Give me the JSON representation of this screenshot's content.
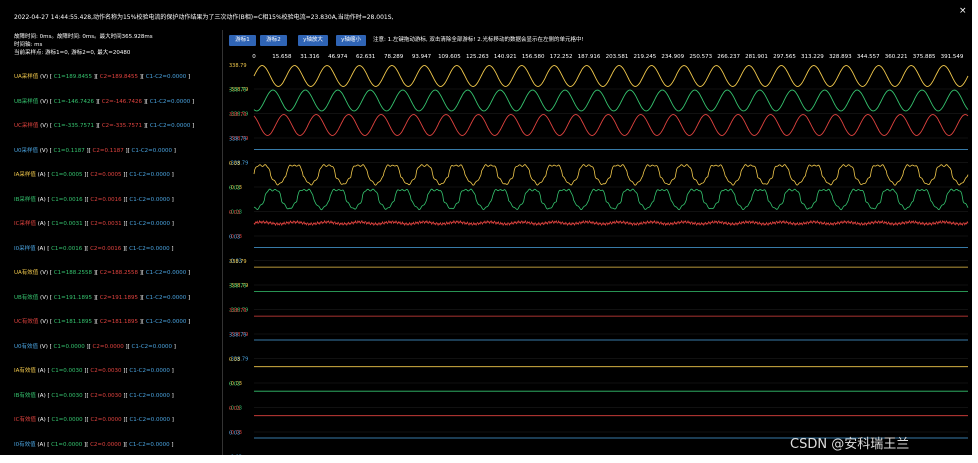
{
  "header": {
    "text": "2022-04-27 14:44:55.428,动作名称为15%校验电流的保护动作结果为了三次动作(B相)=C相15%校验电流=23.830A,当动作时=28.001S,"
  },
  "window": {
    "close_label": "×"
  },
  "info": {
    "line1": "故障时间: 0ms。故障时间: 0ms。最大时间365.928ms",
    "line2": "时间轴: ms",
    "line3": "当前采样点: 游标1=0, 游标2=0, 最大=20480"
  },
  "toolbar": {
    "cursor1": "游标1",
    "cursor2": "游标2",
    "y_zoom_in": "y轴放大",
    "y_zoom_out": "y轴缩小",
    "notice": "注意: 1.左键拖动游标, 双击清除全部游标! 2.光标移动的数据会显示在左侧的单元格中!"
  },
  "axis": {
    "ticks": [
      "0",
      "15.658",
      "31.316",
      "46.974",
      "62.631",
      "78.289",
      "93.947",
      "109.605",
      "125.263",
      "140.921",
      "156.580",
      "172.252",
      "187.916",
      "203.581",
      "219.245",
      "234.909",
      "250.573",
      "266.237",
      "281.901",
      "297.565",
      "313.229",
      "328.893",
      "344.557",
      "360.221",
      "375.885",
      "391.549"
    ]
  },
  "channels": [
    {
      "name": "UA采样值",
      "unit": "(V)",
      "c1": "C1=189.8455",
      "c2": "C2=189.8455",
      "diff": "C1-C2=0.0000",
      "color": "#f2c94c",
      "ymax": "338.79",
      "ymin": "-338.79",
      "wave": "sine",
      "phase": 0,
      "amp": 1
    },
    {
      "name": "UB采样值",
      "unit": "(V)",
      "c1": "C1=-146.7426",
      "c2": "C2=-146.7426",
      "diff": "C1-C2=0.0000",
      "color": "#35c46f",
      "ymax": "338.79",
      "ymin": "-338.79",
      "wave": "sine",
      "phase": -2.094,
      "amp": 1
    },
    {
      "name": "UC采样值",
      "unit": "(V)",
      "c1": "C1=-335.7571",
      "c2": "C2=-335.7571",
      "diff": "C1-C2=0.0000",
      "color": "#e0433f",
      "ymax": "338.79",
      "ymin": "-338.79",
      "wave": "sine",
      "phase": 2.094,
      "amp": 1
    },
    {
      "name": "U0采样值",
      "unit": "(V)",
      "c1": "C1=0.1187",
      "c2": "C2=0.1187",
      "diff": "C1-C2=0.0000",
      "color": "#4aa3df",
      "ymax": "338.79",
      "ymin": "-338.79",
      "wave": "flat",
      "phase": 0,
      "amp": 0
    },
    {
      "name": "IA采样值",
      "unit": "(A)",
      "c1": "C1=0.0005",
      "c2": "C2=0.0005",
      "diff": "C1-C2=0.0000",
      "color": "#f2c94c",
      "ymax": "0.03",
      "ymin": "-0.03",
      "wave": "distorted",
      "phase": 0,
      "amp": 0.85
    },
    {
      "name": "IB采样值",
      "unit": "(A)",
      "c1": "C1=0.0016",
      "c2": "C2=0.0016",
      "diff": "C1-C2=0.0000",
      "color": "#35c46f",
      "ymax": "0.03",
      "ymin": "-0.03",
      "wave": "distorted",
      "phase": -2.094,
      "amp": 0.85
    },
    {
      "name": "IC采样值",
      "unit": "(A)",
      "c1": "C1=0.0031",
      "c2": "C2=0.0031",
      "diff": "C1-C2=0.0000",
      "color": "#e0433f",
      "ymax": "0.03",
      "ymin": "-0.03",
      "wave": "noise",
      "phase": 0,
      "amp": 0.18
    },
    {
      "name": "I0采样值",
      "unit": "(A)",
      "c1": "C1=0.0016",
      "c2": "C2=0.0016",
      "diff": "C1-C2=0.0000",
      "color": "#4aa3df",
      "ymax": "0.03",
      "ymin": "-0.03",
      "wave": "flat",
      "phase": 0,
      "amp": 0
    },
    {
      "name": "UA有效值",
      "unit": "(V)",
      "c1": "C1=188.2558",
      "c2": "C2=188.2558",
      "diff": "C1-C2=0.0000",
      "color": "#f2c94c",
      "ymax": "338.79",
      "ymin": "-338.79",
      "wave": "level",
      "level": 0.45
    },
    {
      "name": "UB有效值",
      "unit": "(V)",
      "c1": "C1=191.1895",
      "c2": "C2=191.1895",
      "diff": "C1-C2=0.0000",
      "color": "#35c46f",
      "ymax": "338.79",
      "ymin": "-338.79",
      "wave": "level",
      "level": 0.45
    },
    {
      "name": "UC有效值",
      "unit": "(V)",
      "c1": "C1=181.1895",
      "c2": "C2=181.1895",
      "diff": "C1-C2=0.0000",
      "color": "#e0433f",
      "ymax": "338.79",
      "ymin": "-338.79",
      "wave": "level",
      "level": 0.45
    },
    {
      "name": "U0有效值",
      "unit": "(V)",
      "c1": "C1=0.0000",
      "c2": "C2=0.0000",
      "diff": "C1-C2=0.0000",
      "color": "#4aa3df",
      "ymax": "338.79",
      "ymin": "-338.79",
      "wave": "level",
      "level": 0.5
    },
    {
      "name": "IA有效值",
      "unit": "(A)",
      "c1": "C1=0.0030",
      "c2": "C2=0.0030",
      "diff": "C1-C2=0.0000",
      "color": "#f2c94c",
      "ymax": "0.03",
      "ymin": "-0.03",
      "wave": "level",
      "level": 0.3
    },
    {
      "name": "IB有效值",
      "unit": "(A)",
      "c1": "C1=0.0030",
      "c2": "C2=0.0030",
      "diff": "C1-C2=0.0000",
      "color": "#35c46f",
      "ymax": "0.03",
      "ymin": "-0.03",
      "wave": "level",
      "level": 0.3
    },
    {
      "name": "IC有效值",
      "unit": "(A)",
      "c1": "C1=0.0000",
      "c2": "C2=0.0000",
      "diff": "C1-C2=0.0000",
      "color": "#e0433f",
      "ymax": "0.03",
      "ymin": "-0.03",
      "wave": "level",
      "level": 0.3
    },
    {
      "name": "I0有效值",
      "unit": "(A)",
      "c1": "C1=0.0000",
      "c2": "C2=0.0000",
      "diff": "C1-C2=0.0000",
      "color": "#4aa3df",
      "ymax": "0.03",
      "ymin": "-0.03",
      "wave": "level",
      "level": 0.5
    }
  ],
  "watermark": "CSDN @安科瑞王兰"
}
